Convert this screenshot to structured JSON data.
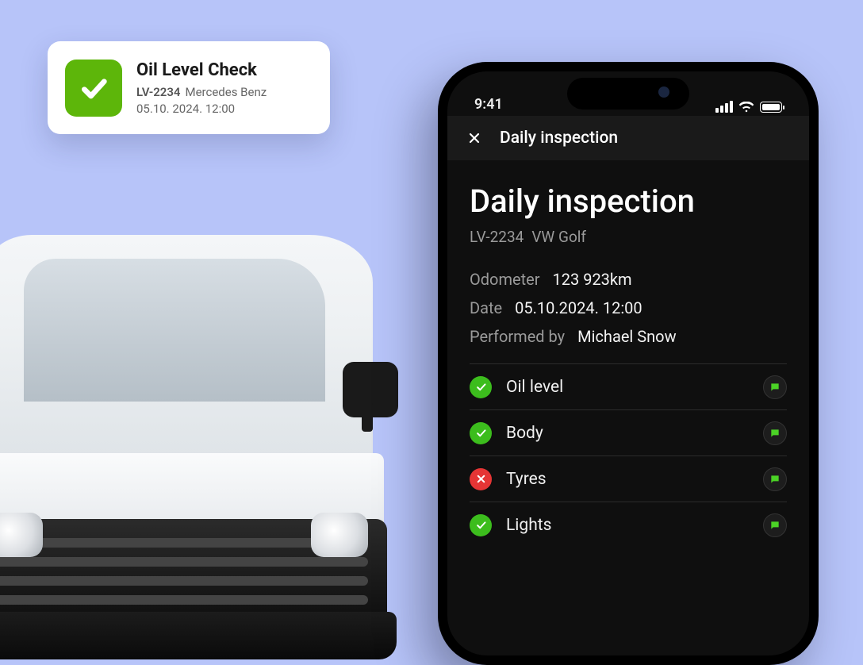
{
  "card": {
    "title": "Oil Level Check",
    "plate": "LV-2234",
    "vehicle": "Mercedes Benz",
    "datetime": "05.10. 2024. 12:00"
  },
  "phone": {
    "statusbar": {
      "time": "9:41"
    },
    "header": {
      "title": "Daily inspection"
    },
    "page_title": "Daily inspection",
    "vehicle": {
      "plate": "LV-2234",
      "model": "VW Golf"
    },
    "meta": {
      "odometer_label": "Odometer",
      "odometer_value": "123 923km",
      "date_label": "Date",
      "date_value": "05.10.2024. 12:00",
      "performed_label": "Performed by",
      "performed_value": "Michael Snow"
    },
    "items": [
      {
        "label": "Oil level",
        "status": "pass"
      },
      {
        "label": "Body",
        "status": "pass"
      },
      {
        "label": "Tyres",
        "status": "fail"
      },
      {
        "label": "Lights",
        "status": "pass"
      }
    ]
  }
}
